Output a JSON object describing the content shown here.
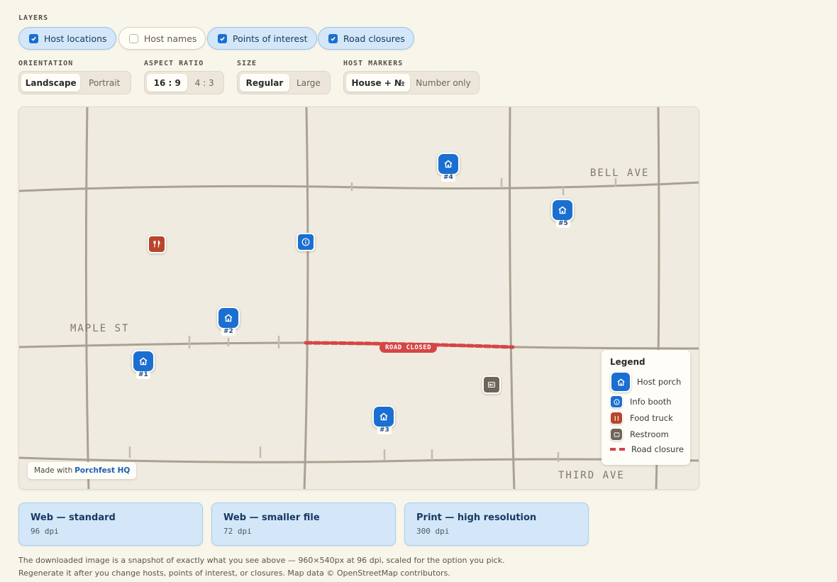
{
  "layers": {
    "label": "LAYERS",
    "items": [
      {
        "label": "Host locations",
        "checked": true
      },
      {
        "label": "Host names",
        "checked": false
      },
      {
        "label": "Points of interest",
        "checked": true
      },
      {
        "label": "Road closures",
        "checked": true
      }
    ]
  },
  "orientation": {
    "label": "ORIENTATION",
    "options": [
      "Landscape",
      "Portrait"
    ],
    "selected": "Landscape"
  },
  "aspect_ratio": {
    "label": "ASPECT RATIO",
    "options": [
      "16 : 9",
      "4 : 3"
    ],
    "selected": "16 : 9"
  },
  "size": {
    "label": "SIZE",
    "options": [
      "Regular",
      "Large"
    ],
    "selected": "Regular"
  },
  "host_markers": {
    "label": "HOST MARKERS",
    "options": [
      "House + №",
      "Number only"
    ],
    "selected": "House + №"
  },
  "map": {
    "streets": {
      "bell": "BELL AVE",
      "maple": "MAPLE ST",
      "third": "THIRD AVE"
    },
    "hosts": [
      "#1",
      "#2",
      "#3",
      "#4",
      "#5"
    ],
    "closure_label": "ROAD CLOSED",
    "credit_prefix": "Made with",
    "credit_link": "Porchfest HQ",
    "legend": {
      "title": "Legend",
      "host_porch": "Host porch",
      "info_booth": "Info booth",
      "food_truck": "Food truck",
      "restroom": "Restroom",
      "road_closure": "Road closure"
    }
  },
  "downloads": [
    {
      "title": "Web — standard",
      "sub": "96 dpi"
    },
    {
      "title": "Web — smaller file",
      "sub": "72 dpi"
    },
    {
      "title": "Print — high resolution",
      "sub": "300 dpi"
    }
  ],
  "note": "The downloaded image is a snapshot of exactly what you see above — 960×540px at 96 dpi, scaled for the option you pick. Regenerate it after you change hosts, points of interest, or closures. Map data © OpenStreetMap contributors.",
  "colors": {
    "accent": "#1a6fd0",
    "closure": "#d64545",
    "food_truck": "#b8452c",
    "restroom": "#6e6458",
    "background": "#f8f5ea"
  }
}
